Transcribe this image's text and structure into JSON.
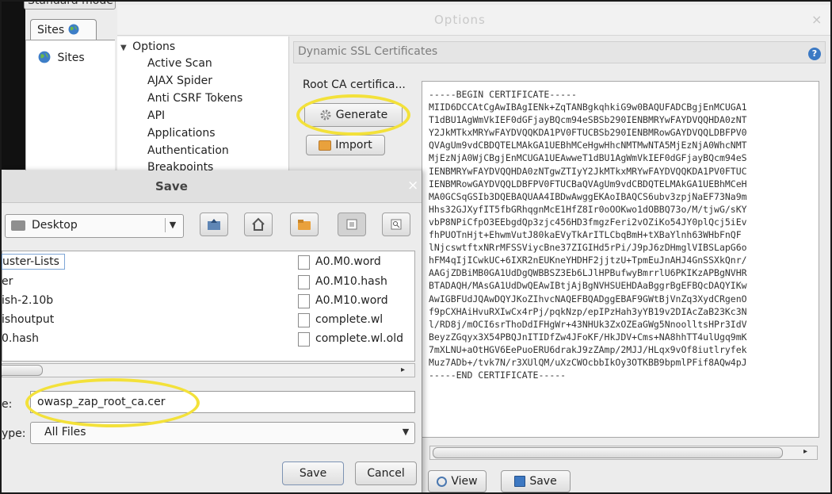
{
  "main": {
    "mode_select": "Standard mode",
    "sites_tab": "Sites",
    "sites_node": "Sites"
  },
  "options_dialog": {
    "title": "Options",
    "close": "×",
    "tree_root": "Options",
    "tree_items": [
      "Active Scan",
      "AJAX Spider",
      "Anti CSRF Tokens",
      "API",
      "Applications",
      "Authentication",
      "Breakpoints"
    ],
    "panel_title": "Dynamic SSL Certificates",
    "help": "?",
    "root_ca_label": "Root CA certifica...",
    "generate_label": "Generate",
    "import_label": "Import",
    "view_label": "View",
    "save_label": "Save",
    "certificate_lines": [
      "-----BEGIN CERTIFICATE-----",
      "MIID6DCCAtCgAwIBAgIENk+ZqTANBgkqhkiG9w0BAQUFADCBgjEnMCUGA1",
      "T1dBU1AgWmVkIEF0dGFjayBQcm94eSBSb290IENBMRYwFAYDVQQHDA0zNT",
      "Y2JkMTkxMRYwFAYDVQQKDA1PV0FTUCBSb290IENBMRowGAYDVQQLDBFPV0",
      "QVAgUm9vdCBDQTELMAkGA1UEBhMCeHgwHhcNMTMwNTA5MjEzNjA0WhcNMT",
      "MjEzNjA0WjCBgjEnMCUGA1UEAwweT1dBU1AgWmVkIEF0dGFjayBQcm94eS",
      "IENBMRYwFAYDVQQHDA0zNTgwZTIyY2JkMTkxMRYwFAYDVQQKDA1PV0FTUC",
      "IENBMRowGAYDVQQLDBFPV0FTUCBaQVAgUm9vdCBDQTELMAkGA1UEBhMCeH",
      "MA0GCSqGSIb3DQEBAQUAA4IBDwAwggEKAoIBAQCS6ubv3zpjNaEF73Na9m",
      "Hhs32GJXyfIT5fbGRhqgnMcE1HfZ8Ir0oOOKwo1dOBBQ73o/M/tjwG/sKY",
      "vbP8NPiCfpO3EEbgdQp3zjc456HD3fmgzFeri2vOZiKo54JY0plQcj5iEv",
      "fhPUOTnHjt+EhwmVutJ80kaEVyTkArITLCbqBmH+tXBaYlnh63WHbFnQF",
      "lNjcswtftxNRrMFSSViycBne37ZIGIHd5rPi/J9pJ6zDHmglVIBSLapG6o",
      "hFM4qIjICwkUC+6IXR2nEUKneYHDHF2jjtzU+TpmEuJnAHJ4GnSSXkQnr/",
      "AAGjZDBiMB0GA1UdDgQWBBSZ3Eb6LJlHPBufwyBmrrlU6PKIKzAPBgNVHR",
      "BTADAQH/MAsGA1UdDwQEAwIBtjAjBgNVHSUEHDAaBggrBgEFBQcDAQYIKw",
      "AwIGBFUdJQAwDQYJKoZIhvcNAQEFBQADggEBAF9GWtBjVnZq3XydCRgenO",
      "f9pCXHAiHvuRXIwCx4rPj/pqkNzp/epIPzHah3yYB19v2DIAcZaB23Kc3N",
      "l/RD8j/mOCI6srThoDdIFHgWr+43NHUk3ZxOZEaGWg5NnoolltsHPr3IdV",
      "BeyzZGqyx3X54PBQJnITIDfZw4JFoKF/HkJDV+Cms+NA8hhTT4ulUgq9mK",
      "7mXLNU+aOtHGV6EePuoERU6drakJ9zZAmp/2MJJ/HLqx9vOf8iutlryfek",
      "Muz7ADb+/tvk7N/r3XUlQM/uXzCWOcbbIkOy3OTKBB9bpmlPFif8AQw4pJ",
      "-----END CERTIFICATE-----"
    ]
  },
  "save_dialog": {
    "title": "Save",
    "close": "×",
    "directory": "Desktop",
    "files_left": [
      "uster-Lists",
      "er",
      "ish-2.10b",
      "ishoutput",
      "0.hash"
    ],
    "files_right": [
      "A0.M0.word",
      "A0.M10.hash",
      "A0.M10.word",
      "complete.wl",
      "complete.wl.old"
    ],
    "file_name_label": "e:",
    "file_name_value": "owasp_zap_root_ca.cer",
    "file_type_label": "ype:",
    "file_type_value": "All Files",
    "save_label": "Save",
    "cancel_label": "Cancel"
  },
  "colors": {
    "highlight": "#f3e13a",
    "globe": "#3d7ec7",
    "folder": "#e9a13c"
  }
}
